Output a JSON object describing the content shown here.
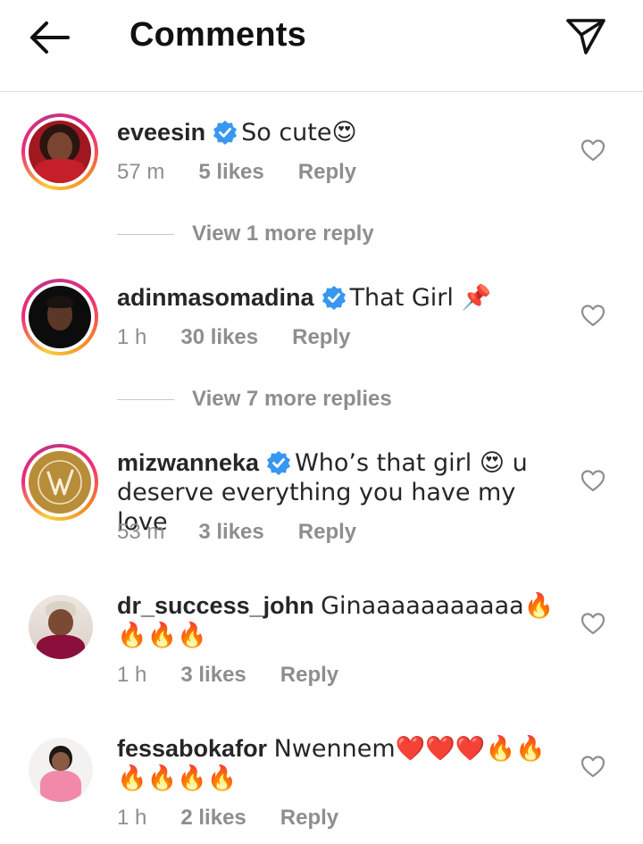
{
  "header": {
    "title": "Comments",
    "back_icon": "arrow-left-icon",
    "share_icon": "paper-plane-icon"
  },
  "comments": [
    {
      "username": "eveesin",
      "verified": true,
      "text": "So cute😍",
      "time": "57 m",
      "likes": "5 likes",
      "reply": "Reply",
      "view_replies": "View 1 more reply"
    },
    {
      "username": "adinmasomadina",
      "verified": true,
      "text": "That Girl 📌",
      "time": "1 h",
      "likes": "30 likes",
      "reply": "Reply",
      "view_replies": "View 7 more replies"
    },
    {
      "username": "mizwanneka",
      "verified": true,
      "text": "Who’s that girl 😍 u deserve everything you have my love",
      "time": "53 m",
      "likes": "3 likes",
      "reply": "Reply"
    },
    {
      "username": "dr_success_john",
      "verified": false,
      "text": "Ginaaaaaaaaaaa🔥🔥🔥🔥",
      "time": "1 h",
      "likes": "3 likes",
      "reply": "Reply"
    },
    {
      "username": "fessabokafor",
      "verified": false,
      "text": "Nwennem❤️❤️❤️🔥🔥🔥🔥🔥🔥",
      "time": "1 h",
      "likes": "2 likes",
      "reply": "Reply"
    }
  ],
  "colors": {
    "verified_blue": "#3897f0",
    "meta_grey": "#8e8e8e",
    "divider": "#dbdbdb"
  }
}
